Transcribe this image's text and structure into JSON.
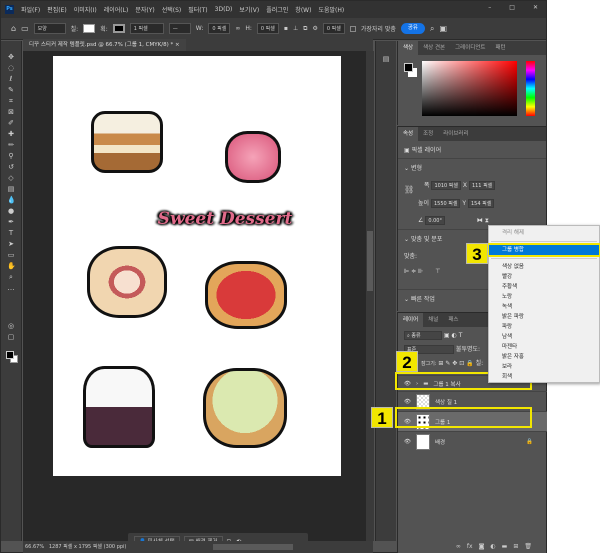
{
  "menubar": {
    "items": [
      "파일(F)",
      "편집(E)",
      "이미지(I)",
      "레이어(L)",
      "문자(Y)",
      "선택(S)",
      "필터(T)",
      "3D(D)",
      "보기(V)",
      "플러그인",
      "창(W)",
      "도움말(H)"
    ]
  },
  "options": {
    "shape_mode": "모양",
    "fill_label": "칠:",
    "stroke_label": "획:",
    "stroke_width": "1 픽셀",
    "w_label": "W:",
    "w_value": "0 픽셀",
    "h_label": "H:",
    "h_value": "0 픽셀",
    "radius": "0 픽셀",
    "align_edges": "가장자리 맞춤",
    "share": "공유"
  },
  "document_tab": "디꾸 스티커 제작 템플릿.psd @ 66.7% (그룹 1, CMYK/8) *",
  "canvas": {
    "title": "Sweet Dessert"
  },
  "contextual_bar": {
    "select_subject": "피사체 선택",
    "remove_bg": "배경 제거"
  },
  "status": {
    "zoom": "66.67%",
    "info": "1287 픽셀 x 1795 픽셀 (300 ppi)"
  },
  "color_panel": {
    "tabs": [
      "색상",
      "색상 견본",
      "그레이디언트",
      "패턴"
    ]
  },
  "properties": {
    "tabs": [
      "속성",
      "조정",
      "라이브러리"
    ],
    "layer_type": "픽셀 레이어",
    "transform": "변형",
    "w_label": "폭",
    "w": "1010 픽셀",
    "x_label": "X",
    "x": "111 픽셀",
    "h_label": "높이",
    "h": "1550 픽셀",
    "y_label": "Y",
    "y": "154 픽셀",
    "angle": "0.00°",
    "align_title": "맞춤 및 분포",
    "align_label": "맞춤:",
    "quick_actions": "빠른 작업"
  },
  "layers": {
    "tabs": [
      "레이어",
      "채널",
      "패스"
    ],
    "filter": "종류",
    "blend": "표준",
    "opacity_label": "불투명도:",
    "lock_label": "잠그기:",
    "fill_label": "칠:",
    "items": [
      "그룹 1 복사",
      "색상 칠 1",
      "그룹 1",
      "배경"
    ]
  },
  "context_menu": {
    "items": [
      "격리 해제",
      "그룹 병합",
      "색상 없음",
      "빨강",
      "주황색",
      "노랑",
      "녹색",
      "밝은 파랑",
      "파랑",
      "남색",
      "마젠타",
      "밝은 자홍",
      "보라",
      "회색"
    ]
  },
  "annotations": [
    "1",
    "2",
    "3"
  ]
}
